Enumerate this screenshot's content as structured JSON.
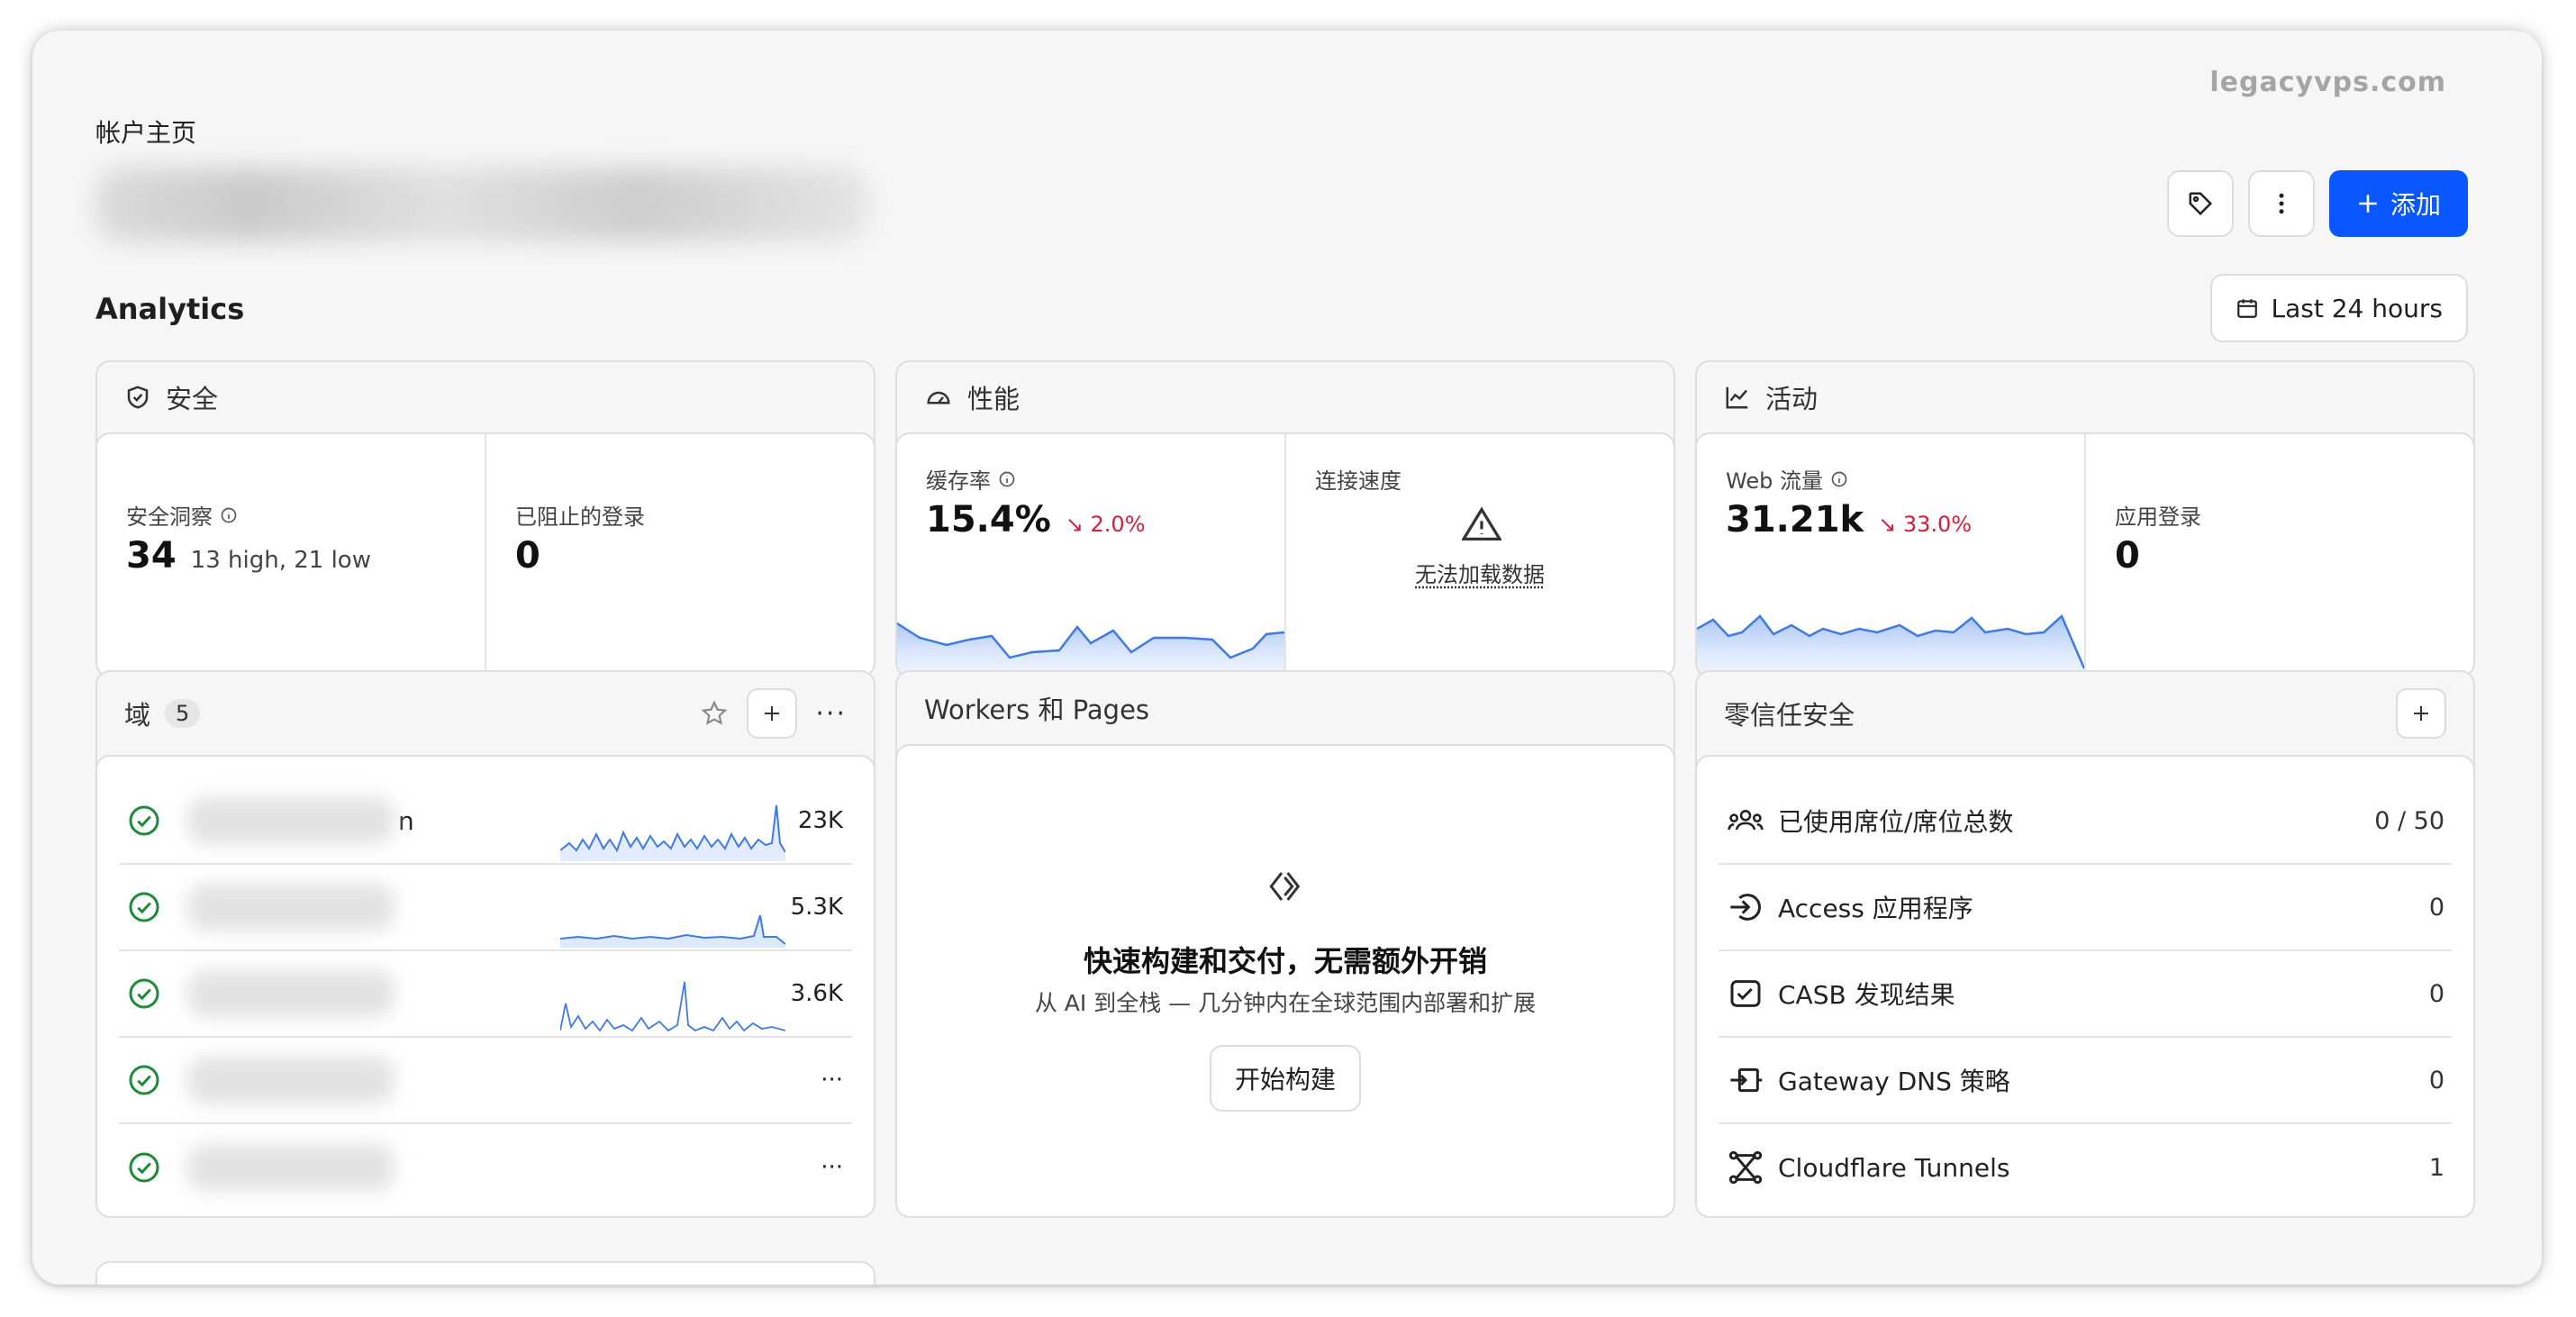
{
  "watermark": "legacyvps.com",
  "breadcrumb": "帐户主页",
  "header": {
    "add_label": "添加",
    "tag_icon": "tag-icon",
    "more_icon": "more-vertical-icon"
  },
  "analytics": {
    "title": "Analytics",
    "range_label": "Last 24 hours",
    "security": {
      "title": "安全",
      "insights_label": "安全洞察",
      "insights_value": "34",
      "insights_sub": "13 high, 21 low",
      "blocked_label": "已阻止的登录",
      "blocked_value": "0"
    },
    "performance": {
      "title": "性能",
      "cache_label": "缓存率",
      "cache_value": "15.4%",
      "cache_delta": "↘ 2.0%",
      "conn_label": "连接速度",
      "conn_error": "无法加载数据"
    },
    "activity": {
      "title": "活动",
      "web_label": "Web 流量",
      "web_value": "31.21k",
      "web_delta": "↘ 33.0%",
      "app_label": "应用登录",
      "app_value": "0"
    }
  },
  "domains": {
    "title": "域",
    "count": "5",
    "rows": [
      {
        "value": "23K",
        "suffix": "n"
      },
      {
        "value": "5.3K"
      },
      {
        "value": "3.6K"
      },
      {
        "value": "···"
      },
      {
        "value": "···"
      }
    ]
  },
  "workers": {
    "title": "Workers 和 Pages",
    "headline": "快速构建和交付，无需额外开销",
    "subline": "从 AI 到全栈 — 几分钟内在全球范围内部署和扩展",
    "button": "开始构建"
  },
  "zero_trust": {
    "title": "零信任安全",
    "rows": [
      {
        "label": "已使用席位/席位总数",
        "value": "0 / 50",
        "icon": "users-icon"
      },
      {
        "label": "Access 应用程序",
        "value": "0",
        "icon": "access-icon"
      },
      {
        "label": "CASB 发现结果",
        "value": "0",
        "icon": "casb-icon"
      },
      {
        "label": "Gateway DNS 策略",
        "value": "0",
        "icon": "gateway-icon"
      },
      {
        "label": "Cloudflare Tunnels",
        "value": "1",
        "icon": "tunnel-icon"
      }
    ]
  },
  "colors": {
    "accent": "#0a57ff",
    "negative": "#d21f3c",
    "success": "#1e8a3a",
    "spark": "#3f7be0"
  }
}
